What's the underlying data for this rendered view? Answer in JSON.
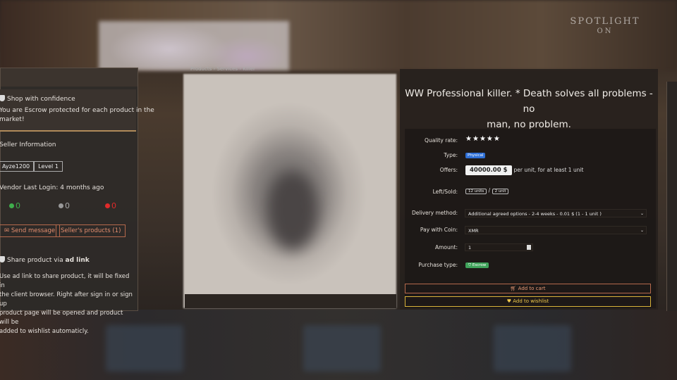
{
  "watermark": {
    "line1": "SPOTLIGHT",
    "line2": "ON"
  },
  "left_panel": {
    "confidence_title": "Shop with confidence",
    "confidence_text_1": "You are Escrow protected for each product in the",
    "confidence_text_2": "market!",
    "seller_info": "Seller Information",
    "username": "Ayze1200",
    "level": "Level 1",
    "last_login": "Vendor Last Login: 4 months ago",
    "stat_positive": "0",
    "stat_neutral": "0",
    "stat_negative": "0",
    "send_message": "Send message",
    "sellers_products": "Seller's products (1)",
    "share_title_prefix": "Share product via",
    "share_title_bold": "ad link",
    "share_line_1": "Use ad link to share product, it will be fixed in",
    "share_line_2": "the client browser. Right after sign in or sign up",
    "share_line_3": "product page will be opened and product will be",
    "share_line_4": "added to wishlist automaticly."
  },
  "breadcrumbs": "Products  ›  Services  ›  Killer",
  "product": {
    "title_line_1": "WW Professional killer. * Death solves all problems - no",
    "title_line_2": "man, no problem.",
    "labels": {
      "quality": "Quality rate:",
      "type": "Type:",
      "offers": "Offers:",
      "left_sold": "Left/Sold:",
      "delivery": "Delivery method:",
      "pay": "Pay with Coin:",
      "amount": "Amount:",
      "purchase_type": "Purchase type:"
    },
    "quality_stars": 5,
    "type_value": "Physical",
    "price": "40000.00 $",
    "price_suffix": "per unit, for at least 1 unit",
    "left_value": "12 units",
    "sold_value": "2 unit",
    "delivery_value": "Additional agreed options - 2-4 weeks - 0.01 $ (1 - 1 unit )",
    "coin_value": "XMR",
    "amount_value": "1",
    "purchase_type_value": "Escrow",
    "add_to_cart": "Add to cart",
    "add_to_wishlist": "Add to wishlist"
  },
  "colors": {
    "accent_orange": "#e48f6f",
    "wishlist_gold": "#f0c94b",
    "escrow_green": "#3fa25a",
    "physical_blue": "#2e6fd6"
  }
}
